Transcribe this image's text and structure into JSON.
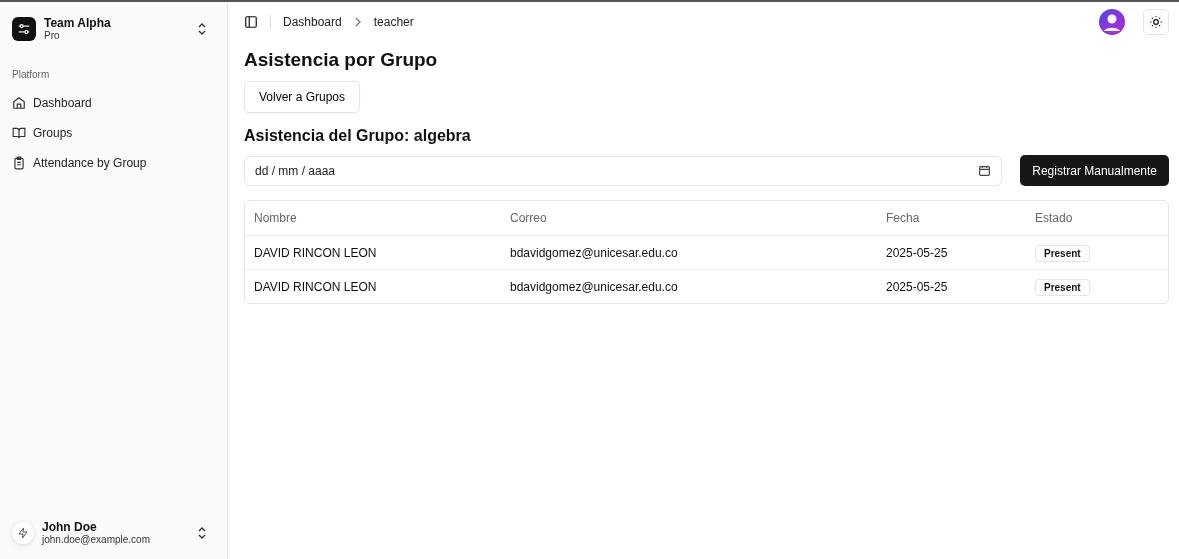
{
  "sidebar": {
    "team": {
      "name": "Team Alpha",
      "plan": "Pro"
    },
    "section_label": "Platform",
    "items": [
      {
        "label": "Dashboard"
      },
      {
        "label": "Groups"
      },
      {
        "label": "Attendance by Group"
      }
    ],
    "user": {
      "name": "John Doe",
      "email": "john.doe@example.com"
    }
  },
  "breadcrumb": [
    "Dashboard",
    "teacher"
  ],
  "page_title": "Asistencia por Grupo",
  "back_button": "Volver a Grupos",
  "section_title": "Asistencia del Grupo: algebra",
  "date_field": {
    "placeholder": "dd / mm / aaaa"
  },
  "register_button": "Registrar Manualmente",
  "table": {
    "columns": [
      "Nombre",
      "Correo",
      "Fecha",
      "Estado"
    ],
    "rows": [
      {
        "nombre": "DAVID RINCON LEON",
        "correo": "bdavidgomez@unicesar.edu.co",
        "fecha": "2025-05-25",
        "estado": "Present"
      },
      {
        "nombre": "DAVID RINCON LEON",
        "correo": "bdavidgomez@unicesar.edu.co",
        "fecha": "2025-05-25",
        "estado": "Present"
      }
    ]
  }
}
